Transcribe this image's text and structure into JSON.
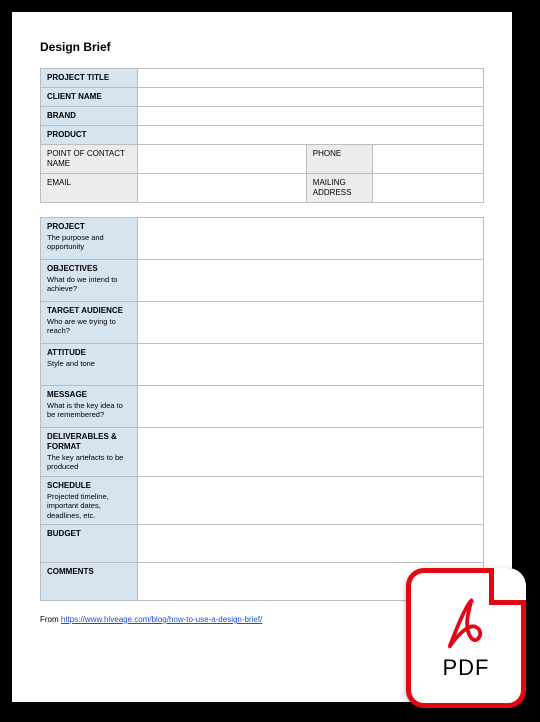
{
  "title": "Design Brief",
  "header_rows": [
    {
      "label": "PROJECT TITLE",
      "value": ""
    },
    {
      "label": "CLIENT NAME",
      "value": ""
    },
    {
      "label": "BRAND",
      "value": ""
    },
    {
      "label": "PRODUCT",
      "value": ""
    }
  ],
  "contact": {
    "poc_label": "POINT OF CONTACT NAME",
    "poc_value": "",
    "phone_label": "PHONE",
    "phone_value": "",
    "email_label": "EMAIL",
    "email_value": "",
    "mailing_label": "MAILING ADDRESS",
    "mailing_value": ""
  },
  "sections": [
    {
      "label": "PROJECT",
      "sub": "The purpose and opportunity",
      "value": ""
    },
    {
      "label": "OBJECTIVES",
      "sub": "What do we intend to achieve?",
      "value": ""
    },
    {
      "label": "TARGET AUDIENCE",
      "sub": "Who are we trying to reach?",
      "value": ""
    },
    {
      "label": "ATTITUDE",
      "sub": "Style and tone",
      "value": ""
    },
    {
      "label": "MESSAGE",
      "sub": "What is the key idea to be remembered?",
      "value": ""
    },
    {
      "label": "DELIVERABLES & FORMAT",
      "sub": "The key artefacts to be produced",
      "value": ""
    },
    {
      "label": "SCHEDULE",
      "sub": "Projected timeline, important dates, deadlines, etc.",
      "value": ""
    },
    {
      "label": "BUDGET",
      "sub": "",
      "value": ""
    },
    {
      "label": "COMMENTS",
      "sub": "",
      "value": ""
    }
  ],
  "source_prefix": "From ",
  "source_url": "https://www.hiveage.com/blog/how-to-use-a-design-brief/",
  "pdf_label": "PDF"
}
